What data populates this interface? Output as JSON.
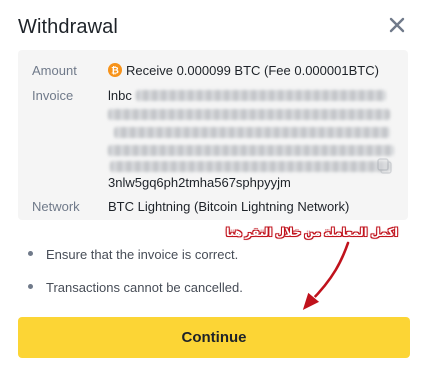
{
  "modal": {
    "title": "Withdrawal",
    "close_icon": "close-icon"
  },
  "details": {
    "amount": {
      "label": "Amount",
      "currency_icon": "btc-icon",
      "text": "Receive 0.000099 BTC  (Fee 0.000001BTC)"
    },
    "invoice": {
      "label": "Invoice",
      "prefix": "lnbc",
      "visible_suffix": "3nlw5gq6ph2tmha567sphpyyjm",
      "redacted": true
    },
    "network": {
      "label": "Network",
      "value": "BTC Lightning (Bitcoin Lightning Network)"
    }
  },
  "notes": [
    "Ensure that the invoice is correct.",
    "Transactions cannot be cancelled."
  ],
  "annotation": {
    "text": "اكمل المعاملة من خلال النقر هنا",
    "color": "#c0121c"
  },
  "actions": {
    "continue_label": "Continue",
    "button_color": "#fcd535"
  }
}
